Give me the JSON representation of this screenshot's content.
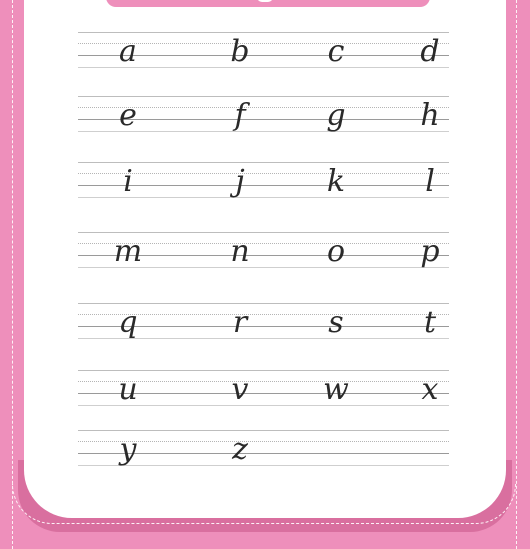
{
  "letter_rows": [
    [
      "a",
      "b",
      "c",
      "d"
    ],
    [
      "e",
      "f",
      "g",
      "h"
    ],
    [
      "i",
      "j",
      "k",
      "l"
    ],
    [
      "m",
      "n",
      "o",
      "p"
    ],
    [
      "q",
      "r",
      "s",
      "t"
    ],
    [
      "u",
      "v",
      "w",
      "x"
    ],
    [
      "y",
      "z"
    ]
  ],
  "colors": {
    "frame_pink": "#ee8fbb",
    "frame_pink_dark": "#d96f9f",
    "card": "#ffffff",
    "ink": "#2a2a2a"
  }
}
